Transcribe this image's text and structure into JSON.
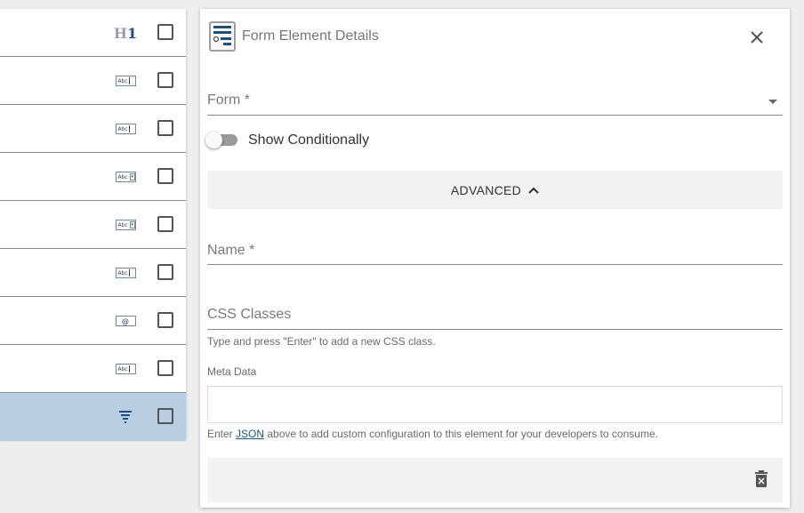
{
  "left_list": {
    "rows": [
      {
        "icon": "heading-h1-icon",
        "icon_text_h": "H",
        "icon_text_1": "1",
        "selected": false
      },
      {
        "icon": "text-input-icon",
        "icon_text": "Abc",
        "selected": false
      },
      {
        "icon": "text-input-icon",
        "icon_text": "Abc",
        "selected": false
      },
      {
        "icon": "dropdown-input-icon",
        "icon_text": "Abc",
        "selected": false
      },
      {
        "icon": "dropdown-input-icon",
        "icon_text": "Abc",
        "selected": false
      },
      {
        "icon": "text-input-icon",
        "icon_text": "Abc",
        "selected": false
      },
      {
        "icon": "email-input-icon",
        "icon_text": "@",
        "selected": false
      },
      {
        "icon": "text-input-icon",
        "icon_text": "Abc",
        "selected": false
      },
      {
        "icon": "form-element-icon",
        "selected": true
      }
    ]
  },
  "panel": {
    "title": "Form Element Details",
    "form_field": {
      "label": "Form *",
      "value": ""
    },
    "show_conditionally": {
      "label": "Show Conditionally",
      "enabled": false
    },
    "advanced": {
      "label": "ADVANCED",
      "expanded": true
    },
    "name_field": {
      "label": "Name *",
      "value": ""
    },
    "css_field": {
      "label": "CSS Classes",
      "hint": "Type and press \"Enter\" to add a new CSS class."
    },
    "meta_data": {
      "label": "Meta Data",
      "value": "",
      "hint_prefix": "Enter ",
      "hint_link": "JSON",
      "hint_suffix": " above to add custom configuration to this element for your developers to consume."
    }
  },
  "colors": {
    "selected_row": "#b7cfe0",
    "icon_blue": "#1f4f7a",
    "panel_bg": "#ffffff",
    "page_bg": "#eeeeee"
  }
}
